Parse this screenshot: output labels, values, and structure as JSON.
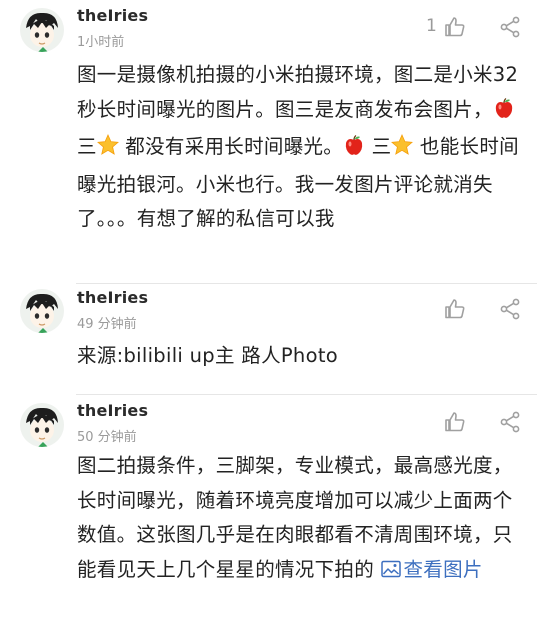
{
  "comments": [
    {
      "user": "theIries",
      "time": "1小时前",
      "likes": "1",
      "text_parts": {
        "p1": "图一是摄像机拍摄的小米拍摄环境，图二是小米32秒长时间曝光的图片。图三是友商发布会图片，",
        "p2": " 三",
        "p3": " 都没有采用长时间曝光。",
        "p4": " 三",
        "p5": " 也能长时间曝光拍银河。小米也行。我一发图片评论就消失了。。。有想了解的私信可以我"
      }
    },
    {
      "user": "theIries",
      "time": "49 分钟前",
      "text": "来源:bilibili up主 路人Photo"
    },
    {
      "user": "theIries",
      "time": "50 分钟前",
      "text": "图二拍摄条件，三脚架，专业模式，最高感光度，长时间曝光，随着环境亮度增加可以减少上面两个数值。这张图几乎是在肉眼都看不清周围环境，只能看见天上几个星星的情况下拍的 ",
      "view_image": "查看图片"
    }
  ],
  "icons": {
    "like": "thumbs-up-icon",
    "share": "share-icon",
    "apple": "red-apple-emoji",
    "star": "star-emoji",
    "image": "image-icon"
  },
  "colors": {
    "link": "#3d6fbf",
    "muted": "#9a9a9a",
    "divider": "#e6e6e6"
  }
}
